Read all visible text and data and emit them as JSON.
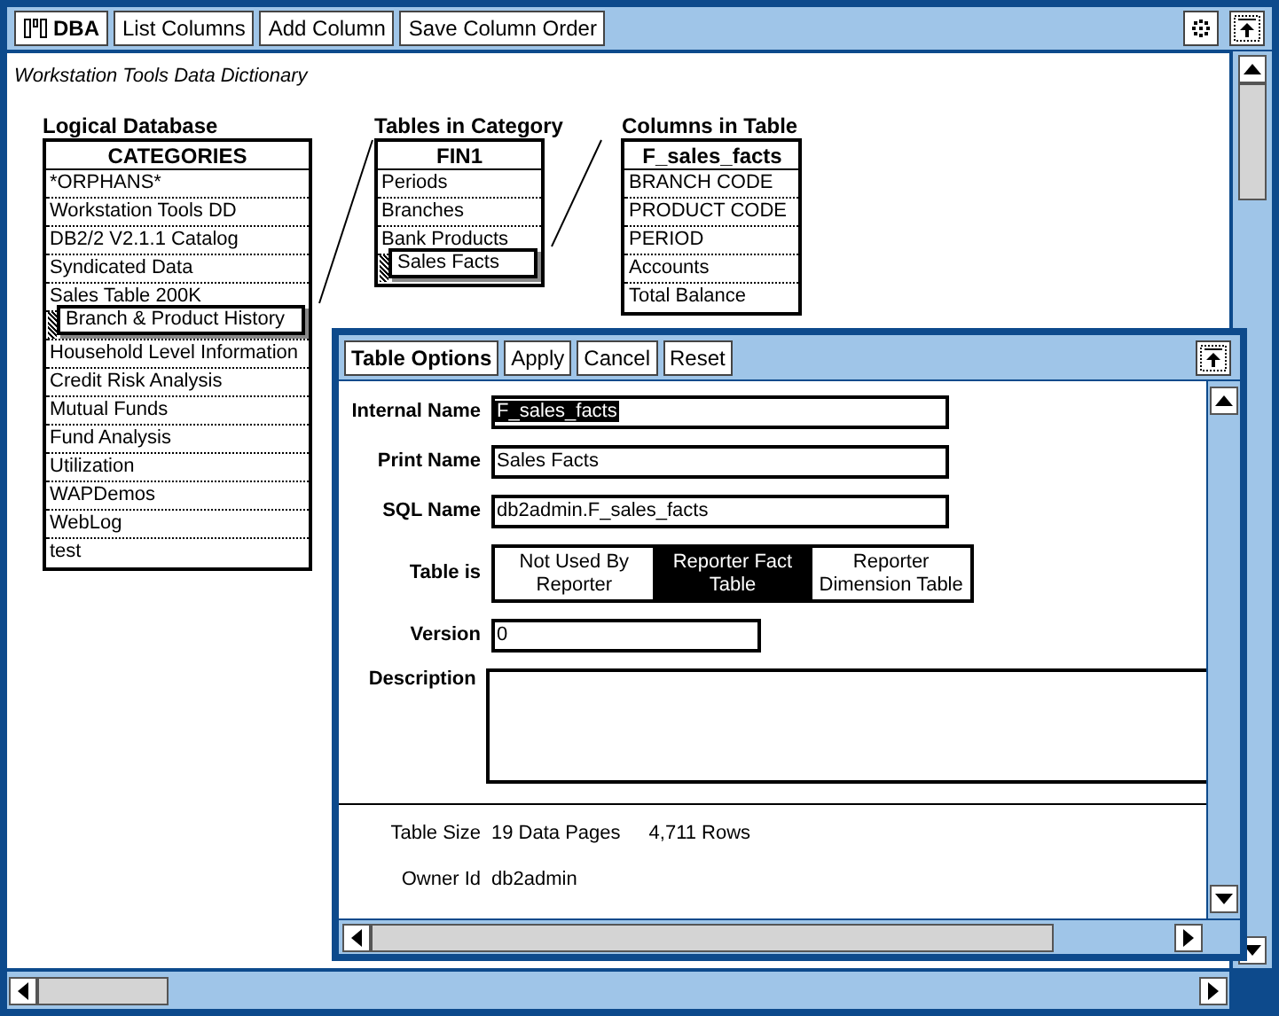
{
  "toolbar": {
    "buttons": [
      {
        "label": "DBA",
        "kind": "app"
      },
      {
        "label": "List Columns",
        "kind": "plain"
      },
      {
        "label": "Add Column",
        "kind": "plain"
      },
      {
        "label": "Save Column Order",
        "kind": "plain"
      }
    ]
  },
  "title": "Workstation Tools Data Dictionary",
  "lists": [
    {
      "caption": "Logical Database",
      "header": "CATEGORIES",
      "rows": [
        {
          "label": "*ORPHANS*",
          "dragged": false
        },
        {
          "label": "Workstation Tools DD",
          "dragged": false
        },
        {
          "label": "DB2/2 V2.1.1 Catalog",
          "dragged": false
        },
        {
          "label": "Syndicated Data",
          "dragged": false
        },
        {
          "label": "Sales Table 200K",
          "dragged": false
        },
        {
          "label": "Branch & Product History",
          "dragged": true
        },
        {
          "label": "Household Level Information",
          "dragged": false
        },
        {
          "label": "Credit Risk Analysis",
          "dragged": false
        },
        {
          "label": "Mutual Funds",
          "dragged": false
        },
        {
          "label": "Fund Analysis",
          "dragged": false
        },
        {
          "label": "Utilization",
          "dragged": false
        },
        {
          "label": "WAPDemos",
          "dragged": false
        },
        {
          "label": "WebLog",
          "dragged": false
        },
        {
          "label": "test",
          "dragged": false
        }
      ]
    },
    {
      "caption": "Tables in Category",
      "header": "FIN1",
      "rows": [
        {
          "label": "Periods",
          "dragged": false
        },
        {
          "label": "Branches",
          "dragged": false
        },
        {
          "label": "Bank Products",
          "dragged": false
        },
        {
          "label": "Sales Facts",
          "dragged": true
        }
      ]
    },
    {
      "caption": "Columns in Table",
      "header": "F_sales_facts",
      "rows": [
        {
          "label": "BRANCH CODE",
          "dragged": false
        },
        {
          "label": "PRODUCT CODE",
          "dragged": false
        },
        {
          "label": "PERIOD",
          "dragged": false
        },
        {
          "label": "Accounts",
          "dragged": false
        },
        {
          "label": "Total Balance",
          "dragged": false
        }
      ]
    }
  ],
  "dialog": {
    "buttons": [
      {
        "label": "Table Options",
        "bold": true
      },
      {
        "label": "Apply",
        "bold": false
      },
      {
        "label": "Cancel",
        "bold": false
      },
      {
        "label": "Reset",
        "bold": false
      }
    ],
    "fields": [
      {
        "kind": "text",
        "label": "Internal Name",
        "value": "F_sales_facts",
        "text_selected": true
      },
      {
        "kind": "text",
        "label": "Print Name",
        "value": "Sales Facts",
        "text_selected": false
      },
      {
        "kind": "text",
        "label": "SQL Name",
        "value": "db2admin.F_sales_facts",
        "text_selected": false
      },
      {
        "kind": "choice",
        "label": "Table is",
        "options": [
          {
            "label": "Not Used By Reporter",
            "selected": false
          },
          {
            "label": "Reporter Fact Table",
            "selected": true
          },
          {
            "label": "Reporter Dimension Table",
            "selected": false
          }
        ]
      },
      {
        "kind": "short",
        "label": "Version",
        "value": "0",
        "text_selected": false
      },
      {
        "kind": "area",
        "label": "Description"
      }
    ],
    "info": [
      {
        "label": "Table Size",
        "values": [
          "19 Data Pages",
          "4,711 Rows"
        ]
      },
      {
        "label": "Owner Id",
        "values": [
          "db2admin"
        ]
      }
    ]
  }
}
